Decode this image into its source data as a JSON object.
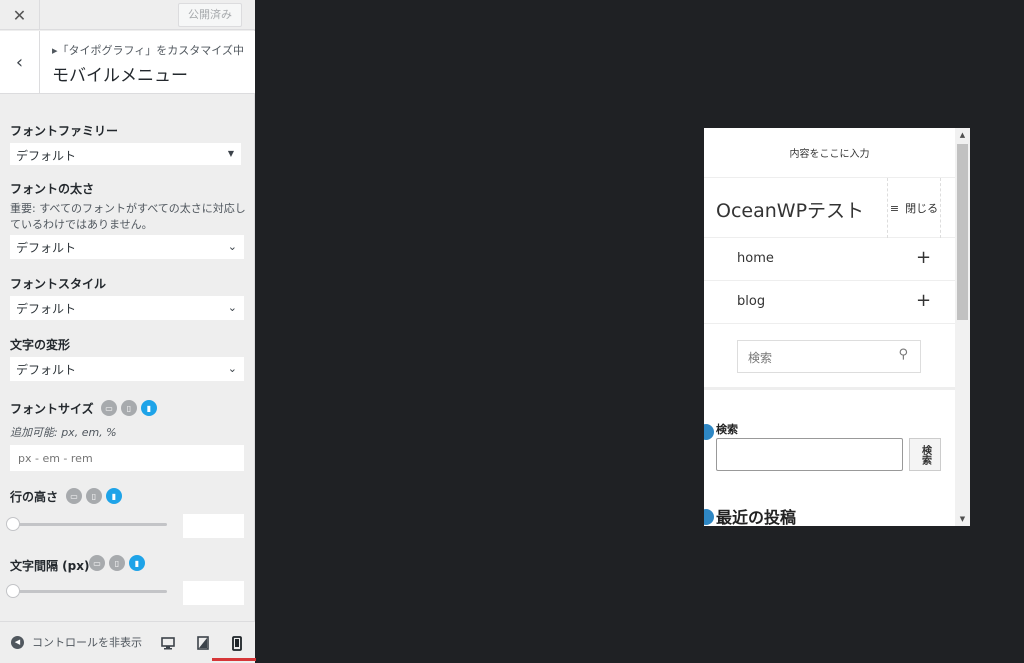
{
  "customizer": {
    "close_icon": "✕",
    "publish_label": "公開済み",
    "breadcrumb": "▸「タイポグラフィ」をカスタマイズ中",
    "section_title": "モバイルメニュー",
    "controls": {
      "font_family": {
        "label": "フォントファミリー",
        "value": "デフォルト"
      },
      "font_weight": {
        "label": "フォントの太さ",
        "description": "重要: すべてのフォントがすべての太さに対応しているわけではありません。",
        "value": "デフォルト"
      },
      "font_style": {
        "label": "フォントスタイル",
        "value": "デフォルト"
      },
      "text_transform": {
        "label": "文字の変形",
        "value": "デフォルト"
      },
      "font_size": {
        "label": "フォントサイズ",
        "description": "追加可能: px, em, %",
        "placeholder": "px - em - rem"
      },
      "line_height": {
        "label": "行の高さ"
      },
      "letter_spacing": {
        "label": "文字間隔 (px)"
      }
    },
    "footer": {
      "collapse_label": "コントロールを非表示",
      "active_device": "mobile"
    }
  },
  "preview": {
    "top_bar_text": "内容をここに入力",
    "site_title": "OceanWPテスト",
    "menu_toggle_label": "閉じる",
    "menu_items": [
      {
        "label": "home"
      },
      {
        "label": "blog"
      }
    ],
    "search_placeholder": "検索",
    "widget_search_title": "検索",
    "widget_search_button": "検索",
    "recent_posts_title": "最近の投稿"
  }
}
